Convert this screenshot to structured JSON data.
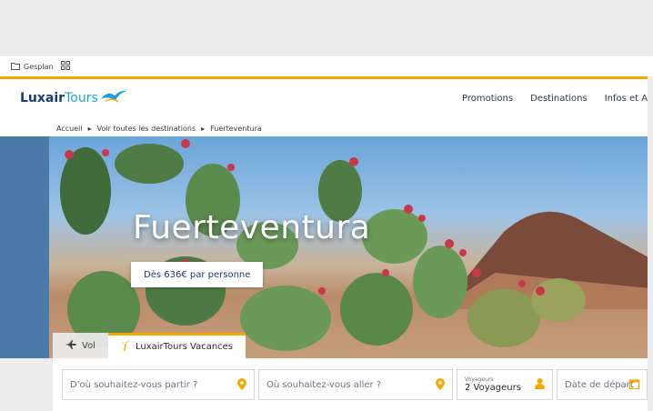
{
  "bookmarks": {
    "items": [
      {
        "label": "Gesplan"
      }
    ]
  },
  "header": {
    "logo_bold": "Luxair",
    "logo_light": "Tours",
    "nav": [
      "Promotions",
      "Destinations",
      "Infos et A"
    ],
    "accent_color": "#f5a800",
    "brand_color": "#1b3b6f"
  },
  "breadcrumbs": [
    "Accueil",
    "Voir toutes les destinations",
    "Fuerteventura"
  ],
  "hero": {
    "title": "Fuerteventura",
    "price_label": "Dès 636€ par personne"
  },
  "tabs": [
    {
      "label": "Vol",
      "icon": "plane-icon"
    },
    {
      "label": "LuxairTours Vacances",
      "icon": "palm-tree-icon"
    }
  ],
  "search": {
    "from_placeholder": "D'où souhaitez-vous partir ?",
    "to_placeholder": "Où souhaitez-vous aller ?",
    "travellers_label": "Voyageurs",
    "travellers_value": "2 Voyageurs",
    "date_placeholder": "Date de départ"
  }
}
